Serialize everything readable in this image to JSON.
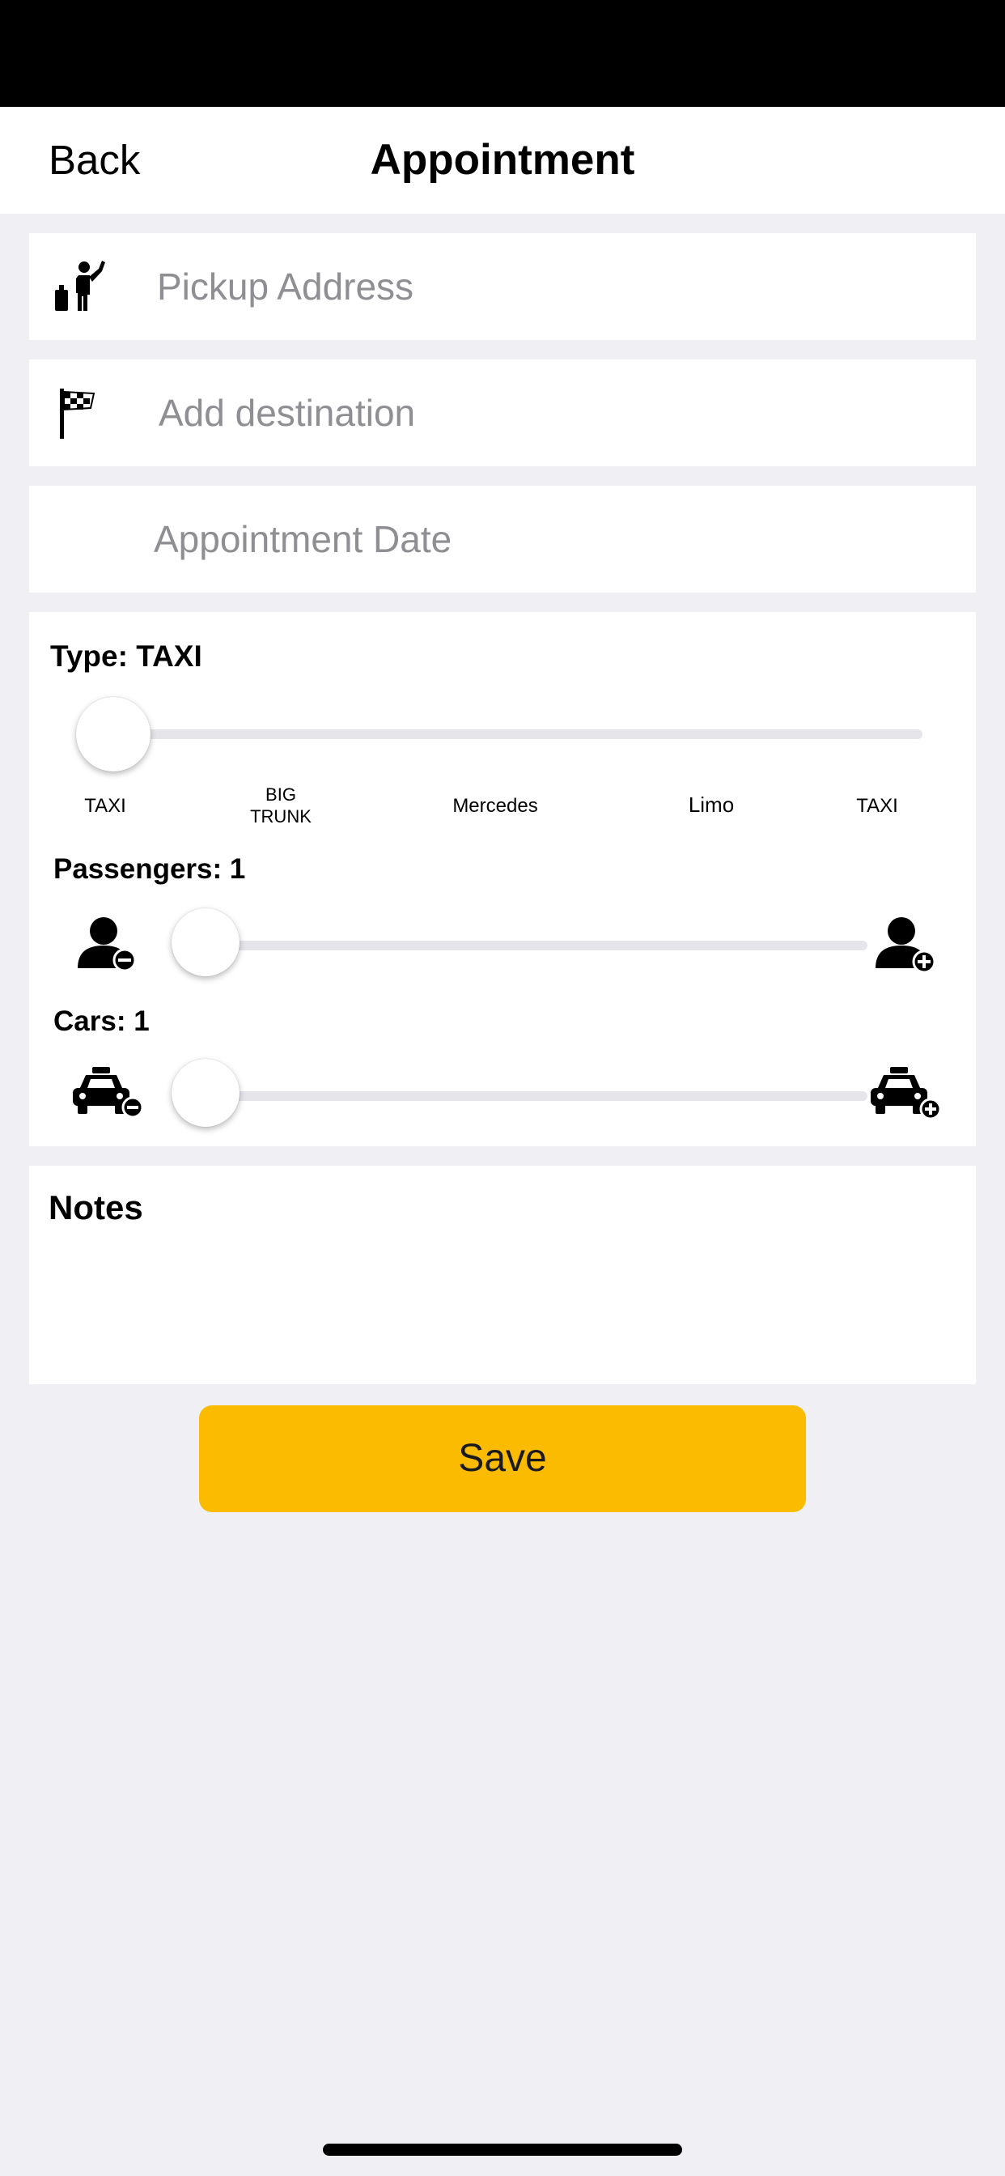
{
  "header": {
    "back_label": "Back",
    "title": "Appointment"
  },
  "fields": {
    "pickup": {
      "placeholder": "Pickup Address",
      "icon": "hailing-person-icon"
    },
    "destination": {
      "placeholder": "Add destination",
      "icon": "checkered-flag-icon"
    },
    "date": {
      "placeholder": "Appointment Date"
    }
  },
  "type_panel": {
    "type_label": "Type: TAXI",
    "type_ticks": [
      {
        "line1": "TAXI",
        "line2": ""
      },
      {
        "line1": "BIG",
        "line2": "TRUNK"
      },
      {
        "line1": "Mercedes",
        "line2": ""
      },
      {
        "line1": "Limo",
        "line2": ""
      },
      {
        "line1": "TAXI",
        "line2": ""
      }
    ],
    "type_index": 0,
    "passengers_label": "Passengers: 1",
    "passengers_value": 1,
    "passengers_icons": {
      "decrease": "person-minus-icon",
      "increase": "person-plus-icon"
    },
    "cars_label": "Cars: 1",
    "cars_value": 1,
    "cars_icons": {
      "decrease": "taxi-minus-icon",
      "increase": "taxi-plus-icon"
    }
  },
  "notes": {
    "label": "Notes",
    "value": ""
  },
  "save": {
    "label": "Save"
  },
  "colors": {
    "accent": "#fbbb00",
    "background": "#efeff4",
    "placeholder": "#8e8e93",
    "track": "#e5e5ea"
  }
}
